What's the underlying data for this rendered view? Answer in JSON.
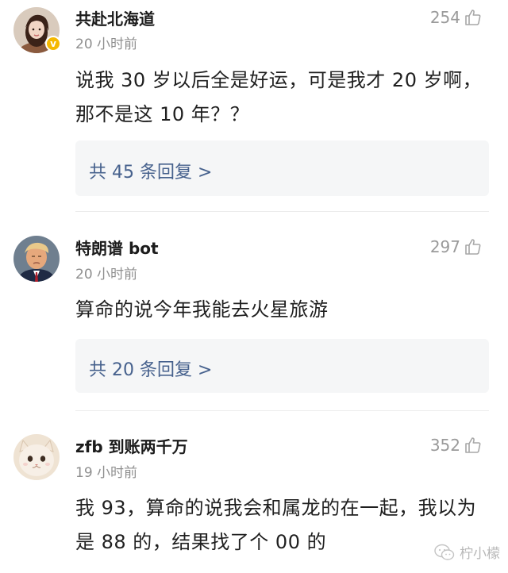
{
  "comments": [
    {
      "username": "共赴北海道",
      "time": "20 小时前",
      "likes": "254",
      "text": "说我 30 岁以后全是好运，可是我才 20 岁啊，那不是这 10 年？？",
      "replies": "共 45 条回复 >",
      "avatar_icon": "woman-portrait",
      "verified": true
    },
    {
      "username": "特朗谱 bot",
      "time": "20 小时前",
      "likes": "297",
      "text": "算命的说今年我能去火星旅游",
      "replies": "共 20 条回复 >",
      "avatar_icon": "man-portrait",
      "verified": false
    },
    {
      "username": "zfb 到账两千万",
      "time": "19 小时前",
      "likes": "352",
      "text": "我 93，算命的说我会和属龙的在一起，我以为是 88 的，结果找了个 00 的",
      "avatar_icon": "cat-portrait",
      "verified": false
    }
  ],
  "watermark": {
    "text": "柠小檬",
    "icon": "wechat-icon"
  },
  "colors": {
    "reply_link": "#46618d",
    "meta_gray": "#8f8f8f",
    "badge": "#f5b800",
    "reply_bg": "#f5f6f7"
  }
}
